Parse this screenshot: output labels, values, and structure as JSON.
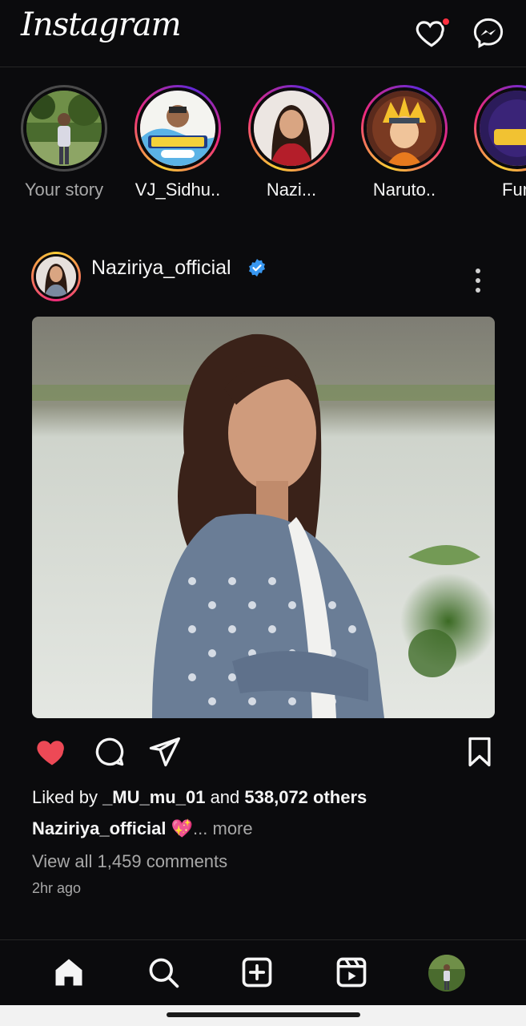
{
  "app": {
    "title": "Instagram"
  },
  "header": {
    "logo": "Instagram",
    "notifications_icon": "heart-icon",
    "messages_icon": "messenger-icon",
    "accent": "#ff3040"
  },
  "stories": [
    {
      "label": "Your story",
      "own": true
    },
    {
      "label": "VJ_Sidhu.."
    },
    {
      "label": "Nazi..."
    },
    {
      "label": "Naruto.."
    },
    {
      "label": "Fun"
    }
  ],
  "post": {
    "username": "Naziriya_official",
    "verified": true,
    "liked": true,
    "likes": {
      "prefix": "Liked by ",
      "user": "_MU_mu_01",
      "middle": " and ",
      "count": "538,072 others"
    },
    "caption": {
      "username": "Naziriya_official",
      "emoji": "💖",
      "more": "... more"
    },
    "comments": "View all 1,459 comments",
    "time": "2hr ago"
  },
  "nav": {
    "items": [
      "home-icon",
      "search-icon",
      "create-icon",
      "reels-icon",
      "profile-avatar"
    ]
  }
}
